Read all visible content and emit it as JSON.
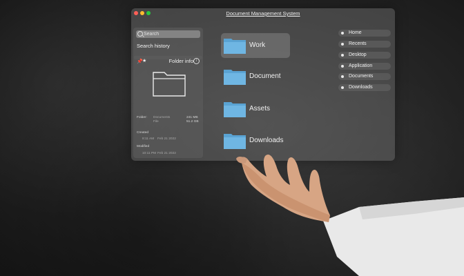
{
  "window": {
    "title": "Document Management System",
    "controls": {
      "close_color": "#ff5f57",
      "minimize_color": "#febc2e",
      "maximize_color": "#28c840"
    }
  },
  "search": {
    "placeholder": "Search",
    "history_label": "Search history"
  },
  "info_panel": {
    "pin_icon": "pin-icon",
    "star_icon": "star-icon",
    "label": "Folder info",
    "info_icon": "info-icon",
    "folder_key": "Folder:",
    "folder_name": "Documents",
    "folder_kind": "File",
    "size_primary": "241 MB",
    "size_secondary": "51.2 GB",
    "created_key": "Created",
    "created_time": "8:11 AM",
    "created_date": "Feb 21 2022",
    "modified_key": "Modified",
    "modified_time": "10:11 PM",
    "modified_date": "Feb 21 2022"
  },
  "folders": [
    {
      "label": "Work",
      "active": true
    },
    {
      "label": "Document",
      "active": false
    },
    {
      "label": "Assets",
      "active": false
    },
    {
      "label": "Downloads",
      "active": false
    }
  ],
  "nav": [
    {
      "label": "Home"
    },
    {
      "label": "Recents"
    },
    {
      "label": "Desktop"
    },
    {
      "label": "Application"
    },
    {
      "label": "Documents"
    },
    {
      "label": "Downloads"
    }
  ],
  "colors": {
    "folder_blue": "#6fb6e3",
    "folder_tab": "#5aa3d3"
  }
}
